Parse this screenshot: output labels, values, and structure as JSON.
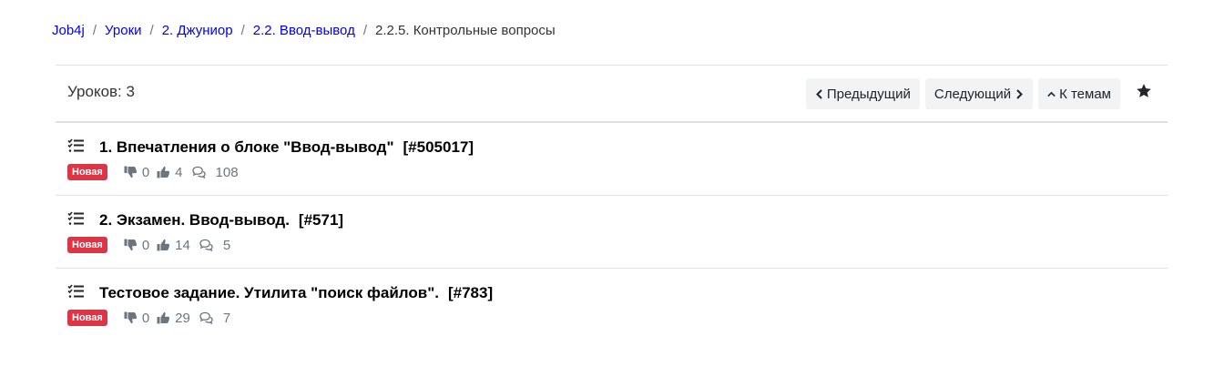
{
  "breadcrumb": {
    "items": [
      "Job4j",
      "Уроки",
      "2. Джуниор",
      "2.2. Ввод-вывод"
    ],
    "current": "2.2.5. Контрольные вопросы",
    "separator": "/"
  },
  "header": {
    "count_label": "Уроков: 3",
    "prev_label": "Предыдущий",
    "next_label": "Следующий",
    "topics_label": "К темам"
  },
  "lessons": [
    {
      "title": "1. Впечатления о блоке \"Ввод-вывод\"",
      "id": "[#505017]",
      "badge": "Новая",
      "dislikes": "0",
      "likes": "4",
      "comments": "108"
    },
    {
      "title": "2. Экзамен. Ввод-вывод.",
      "id": "[#571]",
      "badge": "Новая",
      "dislikes": "0",
      "likes": "14",
      "comments": "5"
    },
    {
      "title": "Тестовое задание. Утилита \"поиск файлов\".",
      "id": "[#783]",
      "badge": "Новая",
      "dislikes": "0",
      "likes": "29",
      "comments": "7"
    }
  ],
  "colors": {
    "link": "#0000ee",
    "badge": "#dc3545",
    "button_bg": "#f1f3f5"
  },
  "icons": [
    "chevron-left-icon",
    "chevron-right-icon",
    "chevron-up-icon",
    "star-icon",
    "tasks-list-icon",
    "thumbs-down-icon",
    "thumbs-up-icon",
    "comments-icon"
  ]
}
